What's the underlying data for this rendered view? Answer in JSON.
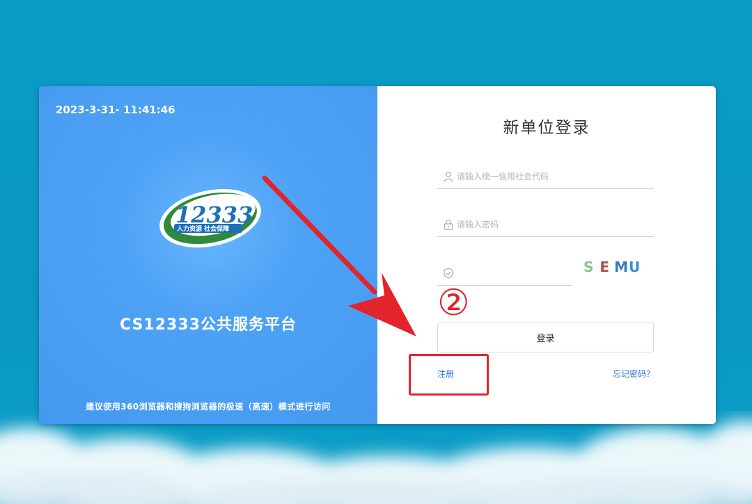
{
  "left_panel": {
    "datetime": "2023-3-31- 11:41:46",
    "logo": {
      "number": "12333",
      "subtitle": "人力资源 社会保障"
    },
    "platform_title": "CS12333公共服务平台",
    "browser_tip": "建议使用360浏览器和搜狗浏览器的极速（高速）模式进行访问"
  },
  "login": {
    "title": "新单位登录",
    "credit_code": {
      "placeholder": "请输入统一信用社会代码",
      "value": ""
    },
    "password": {
      "placeholder": "请输入密码",
      "value": ""
    },
    "captcha": {
      "placeholder": "",
      "value": "",
      "code_chars": [
        "S",
        "E",
        "M",
        "U"
      ],
      "code_colors": [
        "#8ac48a",
        "#b05050",
        "#2f7ec0",
        "#3a8ed0"
      ]
    },
    "login_button": "登录",
    "register_link": "注册",
    "forgot_link": "忘记密码？"
  },
  "annotation": {
    "step_number": "②",
    "color": "#e3242b"
  },
  "colors": {
    "page_bg": "#0b9bc5",
    "left_panel": "#4499f0",
    "link": "#2a6fd6"
  }
}
